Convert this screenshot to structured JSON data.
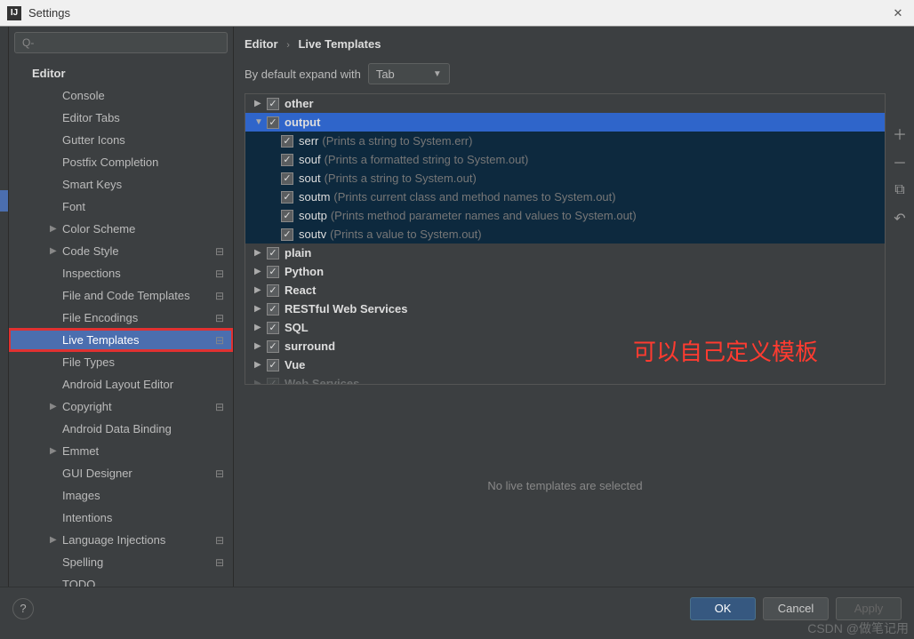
{
  "window": {
    "title": "Settings"
  },
  "search": {
    "placeholder": "Q-"
  },
  "sidebar": {
    "header": "Editor",
    "items": [
      {
        "label": "Console",
        "lvl": "lvl1"
      },
      {
        "label": "Editor Tabs",
        "lvl": "lvl1"
      },
      {
        "label": "Gutter Icons",
        "lvl": "lvl1"
      },
      {
        "label": "Postfix Completion",
        "lvl": "lvl1"
      },
      {
        "label": "Smart Keys",
        "lvl": "lvl1"
      },
      {
        "label": "Font",
        "lvl": "lvl1b"
      },
      {
        "label": "Color Scheme",
        "lvl": "lvl1b",
        "arrow": true
      },
      {
        "label": "Code Style",
        "lvl": "lvl1b",
        "arrow": true,
        "config": true
      },
      {
        "label": "Inspections",
        "lvl": "lvl1b",
        "config": true
      },
      {
        "label": "File and Code Templates",
        "lvl": "lvl1b",
        "config": true
      },
      {
        "label": "File Encodings",
        "lvl": "lvl1b",
        "config": true
      },
      {
        "label": "Live Templates",
        "lvl": "lvl1b",
        "config": true,
        "selected": true,
        "highlighted": true
      },
      {
        "label": "File Types",
        "lvl": "lvl1b"
      },
      {
        "label": "Android Layout Editor",
        "lvl": "lvl1b"
      },
      {
        "label": "Copyright",
        "lvl": "lvl1b",
        "arrow": true,
        "config": true
      },
      {
        "label": "Android Data Binding",
        "lvl": "lvl1b"
      },
      {
        "label": "Emmet",
        "lvl": "lvl1b",
        "arrow": true
      },
      {
        "label": "GUI Designer",
        "lvl": "lvl1b",
        "config": true
      },
      {
        "label": "Images",
        "lvl": "lvl1b"
      },
      {
        "label": "Intentions",
        "lvl": "lvl1b"
      },
      {
        "label": "Language Injections",
        "lvl": "lvl1b",
        "arrow": true,
        "config": true
      },
      {
        "label": "Spelling",
        "lvl": "lvl1b",
        "config": true
      },
      {
        "label": "TODO",
        "lvl": "lvl1b"
      }
    ]
  },
  "breadcrumb": {
    "root": "Editor",
    "leaf": "Live Templates"
  },
  "expand": {
    "label": "By default expand with",
    "value": "Tab"
  },
  "templates": {
    "groups": [
      {
        "name": "other",
        "expanded": false,
        "checked": true
      },
      {
        "name": "output",
        "expanded": true,
        "checked": true,
        "selected": true,
        "children": [
          {
            "name": "serr",
            "desc": "(Prints a string to System.err)"
          },
          {
            "name": "souf",
            "desc": "(Prints a formatted string to System.out)"
          },
          {
            "name": "sout",
            "desc": "(Prints a string to System.out)"
          },
          {
            "name": "soutm",
            "desc": "(Prints current class and method names to System.out)"
          },
          {
            "name": "soutp",
            "desc": "(Prints method parameter names and values to System.out)"
          },
          {
            "name": "soutv",
            "desc": "(Prints a value to System.out)"
          }
        ]
      },
      {
        "name": "plain",
        "expanded": false,
        "checked": true
      },
      {
        "name": "Python",
        "expanded": false,
        "checked": true
      },
      {
        "name": "React",
        "expanded": false,
        "checked": true
      },
      {
        "name": "RESTful Web Services",
        "expanded": false,
        "checked": true
      },
      {
        "name": "SQL",
        "expanded": false,
        "checked": true
      },
      {
        "name": "surround",
        "expanded": false,
        "checked": true
      },
      {
        "name": "Vue",
        "expanded": false,
        "checked": true
      },
      {
        "name": "Web Services",
        "expanded": false,
        "checked": true,
        "cutoff": true
      }
    ]
  },
  "status": {
    "message": "No live templates are selected"
  },
  "annotation": {
    "text": "可以自己定义模板"
  },
  "footer": {
    "ok": "OK",
    "cancel": "Cancel",
    "apply": "Apply",
    "help": "?"
  },
  "watermark": "CSDN @做笔记用"
}
